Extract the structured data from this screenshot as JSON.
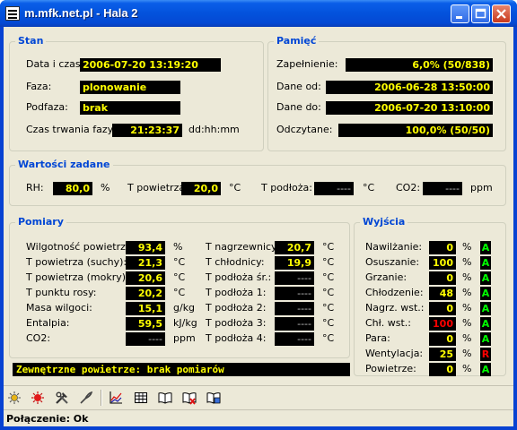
{
  "window": {
    "title": "m.mfk.net.pl - Hala 2"
  },
  "stan": {
    "title": "Stan",
    "data_label": "Data i czas:",
    "data_value": "2006-07-20 13:19:20",
    "faza_label": "Faza:",
    "faza_value": "plonowanie",
    "podfaza_label": "Podfaza:",
    "podfaza_value": "brak",
    "czas_label": "Czas trwania fazy:",
    "czas_value": "21:23:37",
    "czas_unit": "dd:hh:mm"
  },
  "pamiec": {
    "title": "Pamięć",
    "zapelnienie_label": "Zapełnienie:",
    "zapelnienie_value": "6,0% (50/838)",
    "dane_od_label": "Dane od:",
    "dane_od_value": "2006-06-28 13:50:00",
    "dane_do_label": "Dane do:",
    "dane_do_value": "2006-07-20 13:10:00",
    "odczytane_label": "Odczytane:",
    "odczytane_value": "100,0% (50/50)"
  },
  "zadane": {
    "title": "Wartości zadane",
    "rh_label": "RH:",
    "rh_value": "80,0",
    "rh_unit": "%",
    "tpow_label": "T powietrza:",
    "tpow_value": "20,0",
    "tpow_unit": "°C",
    "tpod_label": "T podłoża:",
    "tpod_value": "----",
    "tpod_unit": "°C",
    "co2_label": "CO2:",
    "co2_value": "----",
    "co2_unit": "ppm"
  },
  "pomiary": {
    "title": "Pomiary",
    "left": [
      {
        "label": "Wilgotność powietrza:",
        "value": "93,4",
        "unit": "%"
      },
      {
        "label": "T powietrza (suchy):",
        "value": "21,3",
        "unit": "°C"
      },
      {
        "label": "T powietrza (mokry):",
        "value": "20,6",
        "unit": "°C"
      },
      {
        "label": "T punktu rosy:",
        "value": "20,2",
        "unit": "°C"
      },
      {
        "label": "Masa wilgoci:",
        "value": "15,1",
        "unit": "g/kg"
      },
      {
        "label": "Entalpia:",
        "value": "59,5",
        "unit": "kJ/kg"
      },
      {
        "label": "CO2:",
        "value": "----",
        "unit": "ppm"
      }
    ],
    "right": [
      {
        "label": "T nagrzewnicy:",
        "value": "20,7",
        "unit": "°C"
      },
      {
        "label": "T chłodnicy:",
        "value": "19,9",
        "unit": "°C"
      },
      {
        "label": "T podłoża śr.:",
        "value": "----",
        "unit": "°C"
      },
      {
        "label": "T podłoża 1:",
        "value": "----",
        "unit": "°C"
      },
      {
        "label": "T podłoża 2:",
        "value": "----",
        "unit": "°C"
      },
      {
        "label": "T podłoża 3:",
        "value": "----",
        "unit": "°C"
      },
      {
        "label": "T podłoża 4:",
        "value": "----",
        "unit": "°C"
      }
    ]
  },
  "wyjscia": {
    "title": "Wyjścia",
    "rows": [
      {
        "label": "Nawilżanie:",
        "value": "0",
        "unit": "%",
        "state": "A"
      },
      {
        "label": "Osuszanie:",
        "value": "100",
        "unit": "%",
        "state": "A"
      },
      {
        "label": "Grzanie:",
        "value": "0",
        "unit": "%",
        "state": "A"
      },
      {
        "label": "Chłodzenie:",
        "value": "48",
        "unit": "%",
        "state": "A"
      },
      {
        "label": "Nagrz. wst.:",
        "value": "0",
        "unit": "%",
        "state": "A"
      },
      {
        "label": "Chł. wst.:",
        "value": "100",
        "unit": "%",
        "state": "A"
      },
      {
        "label": "Para:",
        "value": "0",
        "unit": "%",
        "state": "A"
      },
      {
        "label": "Wentylacja:",
        "value": "25",
        "unit": "%",
        "state": "R"
      },
      {
        "label": "Powietrze:",
        "value": "0",
        "unit": "%",
        "state": "A"
      }
    ]
  },
  "message": "Zewnętrzne powietrze: brak pomiarów",
  "status": "Połączenie: Ok",
  "toolbar_icons": [
    "sun-icon",
    "alarm-icon",
    "tools-icon",
    "probe-icon",
    "chart-icon",
    "table-icon",
    "book-icon",
    "book-delete-icon",
    "book-export-icon"
  ],
  "colors": {
    "value_text": "#ffff00",
    "value_bg": "#000000",
    "state_ok": "#00ff00",
    "state_alert": "#ff0000",
    "group_title": "#0046d5"
  }
}
